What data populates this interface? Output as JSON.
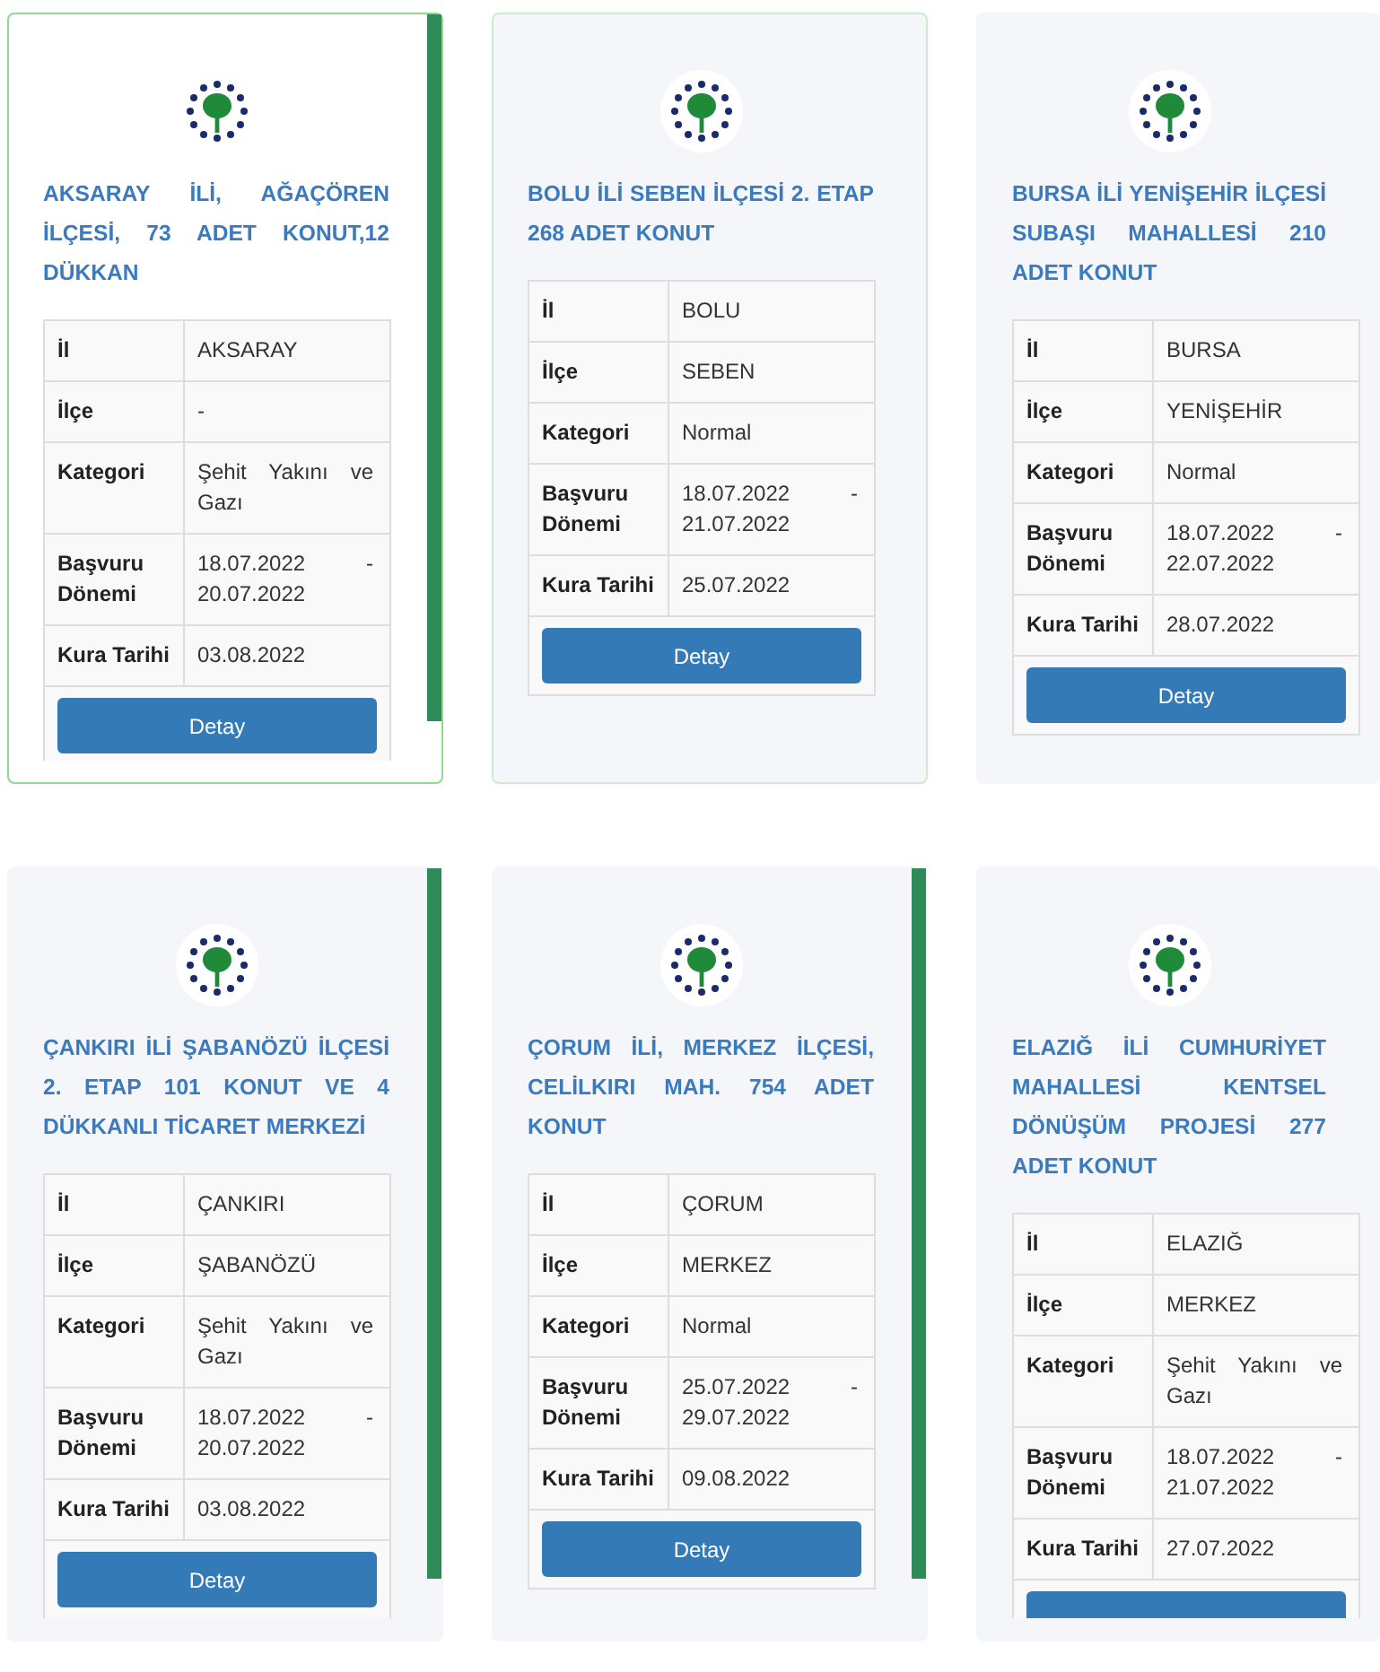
{
  "cards": [
    {
      "title": "AKSARAY İLİ, AĞAÇÖREN İLÇESİ, 73 ADET KONUT,12 DÜKKAN",
      "selected": true,
      "hovered": false,
      "scrollbar": true,
      "rows": [
        {
          "label": "İl",
          "value": "AKSARAY"
        },
        {
          "label": "İlçe",
          "value": "-"
        },
        {
          "label": "Kategori",
          "value": "Şehit Yakını ve Gazı"
        },
        {
          "label": "Başvuru Dönemi",
          "value": "18.07.2022 - 20.07.2022"
        },
        {
          "label": "Kura Tarihi",
          "value": "03.08.2022"
        }
      ],
      "button": "Detay"
    },
    {
      "title": "BOLU İLİ SEBEN İLÇESİ 2. ETAP 268 ADET KONUT",
      "selected": false,
      "hovered": true,
      "scrollbar": false,
      "rows": [
        {
          "label": "İl",
          "value": "BOLU"
        },
        {
          "label": "İlçe",
          "value": "SEBEN"
        },
        {
          "label": "Kategori",
          "value": "Normal"
        },
        {
          "label": "Başvuru Dönemi",
          "value": "18.07.2022 - 21.07.2022"
        },
        {
          "label": "Kura Tarihi",
          "value": "25.07.2022"
        }
      ],
      "button": "Detay"
    },
    {
      "title": "BURSA İLİ YENİŞEHİR İLÇESİ SUBAŞI MAHALLESİ 210 ADET KONUT",
      "selected": false,
      "hovered": false,
      "scrollbar": false,
      "rows": [
        {
          "label": "İl",
          "value": "BURSA"
        },
        {
          "label": "İlçe",
          "value": "YENİŞEHİR"
        },
        {
          "label": "Kategori",
          "value": "Normal"
        },
        {
          "label": "Başvuru Dönemi",
          "value": "18.07.2022 - 22.07.2022"
        },
        {
          "label": "Kura Tarihi",
          "value": "28.07.2022"
        }
      ],
      "button": "Detay"
    },
    {
      "title": "ÇANKIRI İLİ ŞABANÖZÜ İLÇESİ 2. ETAP 101 KONUT VE 4 DÜKKANLI TİCARET MERKEZİ",
      "selected": false,
      "hovered": false,
      "scrollbar": true,
      "rows": [
        {
          "label": "İl",
          "value": "ÇANKIRI"
        },
        {
          "label": "İlçe",
          "value": "ŞABANÖZÜ"
        },
        {
          "label": "Kategori",
          "value": "Şehit Yakını ve Gazı"
        },
        {
          "label": "Başvuru Dönemi",
          "value": "18.07.2022 - 20.07.2022"
        },
        {
          "label": "Kura Tarihi",
          "value": "03.08.2022"
        }
      ],
      "button": "Detay"
    },
    {
      "title": "ÇORUM İLİ, MERKEZ İLÇESİ, CELİLKIRI MAH. 754 ADET KONUT",
      "selected": false,
      "hovered": false,
      "scrollbar": true,
      "rows": [
        {
          "label": "İl",
          "value": "ÇORUM"
        },
        {
          "label": "İlçe",
          "value": "MERKEZ"
        },
        {
          "label": "Kategori",
          "value": "Normal"
        },
        {
          "label": "Başvuru Dönemi",
          "value": "25.07.2022 - 29.07.2022"
        },
        {
          "label": "Kura Tarihi",
          "value": "09.08.2022"
        }
      ],
      "button": "Detay"
    },
    {
      "title": "ELAZIĞ İLİ CUMHURİYET MAHALLESİ KENTSEL DÖNÜŞÜM PROJESİ 277 ADET KONUT",
      "selected": false,
      "hovered": false,
      "scrollbar": false,
      "rows": [
        {
          "label": "İl",
          "value": "ELAZIĞ"
        },
        {
          "label": "İlçe",
          "value": "MERKEZ"
        },
        {
          "label": "Kategori",
          "value": "Şehit Yakını ve Gazı"
        },
        {
          "label": "Başvuru Dönemi",
          "value": "18.07.2022 - 21.07.2022"
        },
        {
          "label": "Kura Tarihi",
          "value": "27.07.2022"
        }
      ]
    }
  ]
}
